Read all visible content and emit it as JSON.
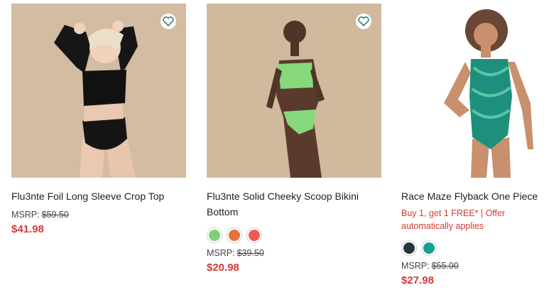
{
  "products": [
    {
      "name": "Flu3nte Foil Long Sleeve Crop Top",
      "msrp_label": "MSRP:",
      "msrp_value": "$59.50",
      "price": "$41.98",
      "wishlist_icon": "heart-outline-icon"
    },
    {
      "name": "Flu3nte Solid Cheeky Scoop Bikini Bottom",
      "msrp_label": "MSRP:",
      "msrp_value": "$39.50",
      "price": "$20.98",
      "wishlist_icon": "heart-outline-icon",
      "swatches": [
        "#7fcf79",
        "#e2733a",
        "#f25a4e"
      ]
    },
    {
      "name": "Race Maze Flyback One Piece",
      "promo": "Buy 1, get 1 FREE* | Offer automatically applies",
      "msrp_label": "MSRP:",
      "msrp_value": "$55.00",
      "price": "$27.98",
      "swatches": [
        "#26363f",
        "#16a08e"
      ]
    }
  ],
  "colors": {
    "accent_red": "#d23b35",
    "heart_teal": "#3c7a77",
    "image_background": "#d1b99e"
  }
}
